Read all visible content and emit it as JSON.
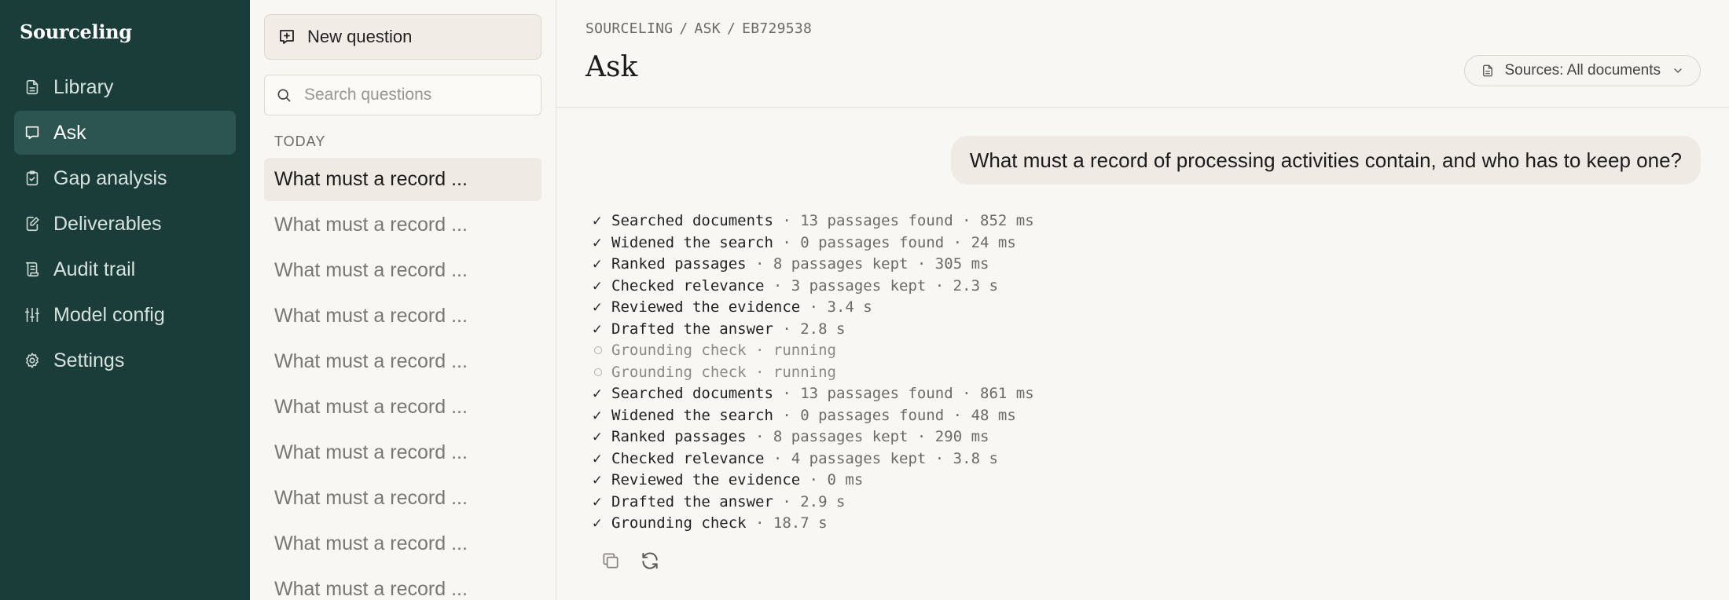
{
  "app": {
    "brand": "Sourceling"
  },
  "sidebar": {
    "items": [
      {
        "label": "Library",
        "icon": "document-icon",
        "active": false
      },
      {
        "label": "Ask",
        "icon": "chat-icon",
        "active": true
      },
      {
        "label": "Gap analysis",
        "icon": "clipboard-check-icon",
        "active": false
      },
      {
        "label": "Deliverables",
        "icon": "file-edit-icon",
        "active": false
      },
      {
        "label": "Audit trail",
        "icon": "scroll-icon",
        "active": false
      },
      {
        "label": "Model config",
        "icon": "sliders-icon",
        "active": false
      },
      {
        "label": "Settings",
        "icon": "gear-icon",
        "active": false
      }
    ]
  },
  "questions": {
    "new_label": "New question",
    "search_placeholder": "Search questions",
    "section_label": "TODAY",
    "items": [
      "What must a record ...",
      "What must a record ...",
      "What must a record ...",
      "What must a record ...",
      "What must a record ...",
      "What must a record ...",
      "What must a record ...",
      "What must a record ...",
      "What must a record ...",
      "What must a record ..."
    ]
  },
  "header": {
    "breadcrumb": [
      "SOURCELING",
      "ASK",
      "EB729538"
    ],
    "title": "Ask",
    "sources_label": "Sources: All documents"
  },
  "chat": {
    "question": "What must a record of processing activities contain, and who has to keep one?",
    "steps": [
      {
        "status": "done",
        "label": "Searched documents",
        "detail": " · 13 passages found · 852 ms"
      },
      {
        "status": "done",
        "label": "Widened the search",
        "detail": " · 0 passages found · 24 ms"
      },
      {
        "status": "done",
        "label": "Ranked passages",
        "detail": " · 8 passages kept · 305 ms"
      },
      {
        "status": "done",
        "label": "Checked relevance",
        "detail": " · 3 passages kept · 2.3 s"
      },
      {
        "status": "done",
        "label": "Reviewed the evidence",
        "detail": " · 3.4 s"
      },
      {
        "status": "done",
        "label": "Drafted the answer",
        "detail": " · 2.8 s"
      },
      {
        "status": "running",
        "label": "Grounding check",
        "detail": " · running"
      },
      {
        "status": "running",
        "label": "Grounding check",
        "detail": " · running"
      },
      {
        "status": "done",
        "label": "Searched documents",
        "detail": " · 13 passages found · 861 ms"
      },
      {
        "status": "done",
        "label": "Widened the search",
        "detail": " · 0 passages found · 48 ms"
      },
      {
        "status": "done",
        "label": "Ranked passages",
        "detail": " · 8 passages kept · 290 ms"
      },
      {
        "status": "done",
        "label": "Checked relevance",
        "detail": " · 4 passages kept · 3.8 s"
      },
      {
        "status": "done",
        "label": "Reviewed the evidence",
        "detail": " · 0 ms"
      },
      {
        "status": "done",
        "label": "Drafted the answer",
        "detail": " · 2.9 s"
      },
      {
        "status": "done",
        "label": "Grounding check",
        "detail": " · 18.7 s"
      }
    ],
    "check_glyph": "✓",
    "actions": [
      "copy-icon",
      "refresh-icon"
    ]
  },
  "colors": {
    "sidebar_bg": "#1a3d3a",
    "sidebar_active": "#2c5450",
    "page_bg": "#f9f7f3"
  }
}
